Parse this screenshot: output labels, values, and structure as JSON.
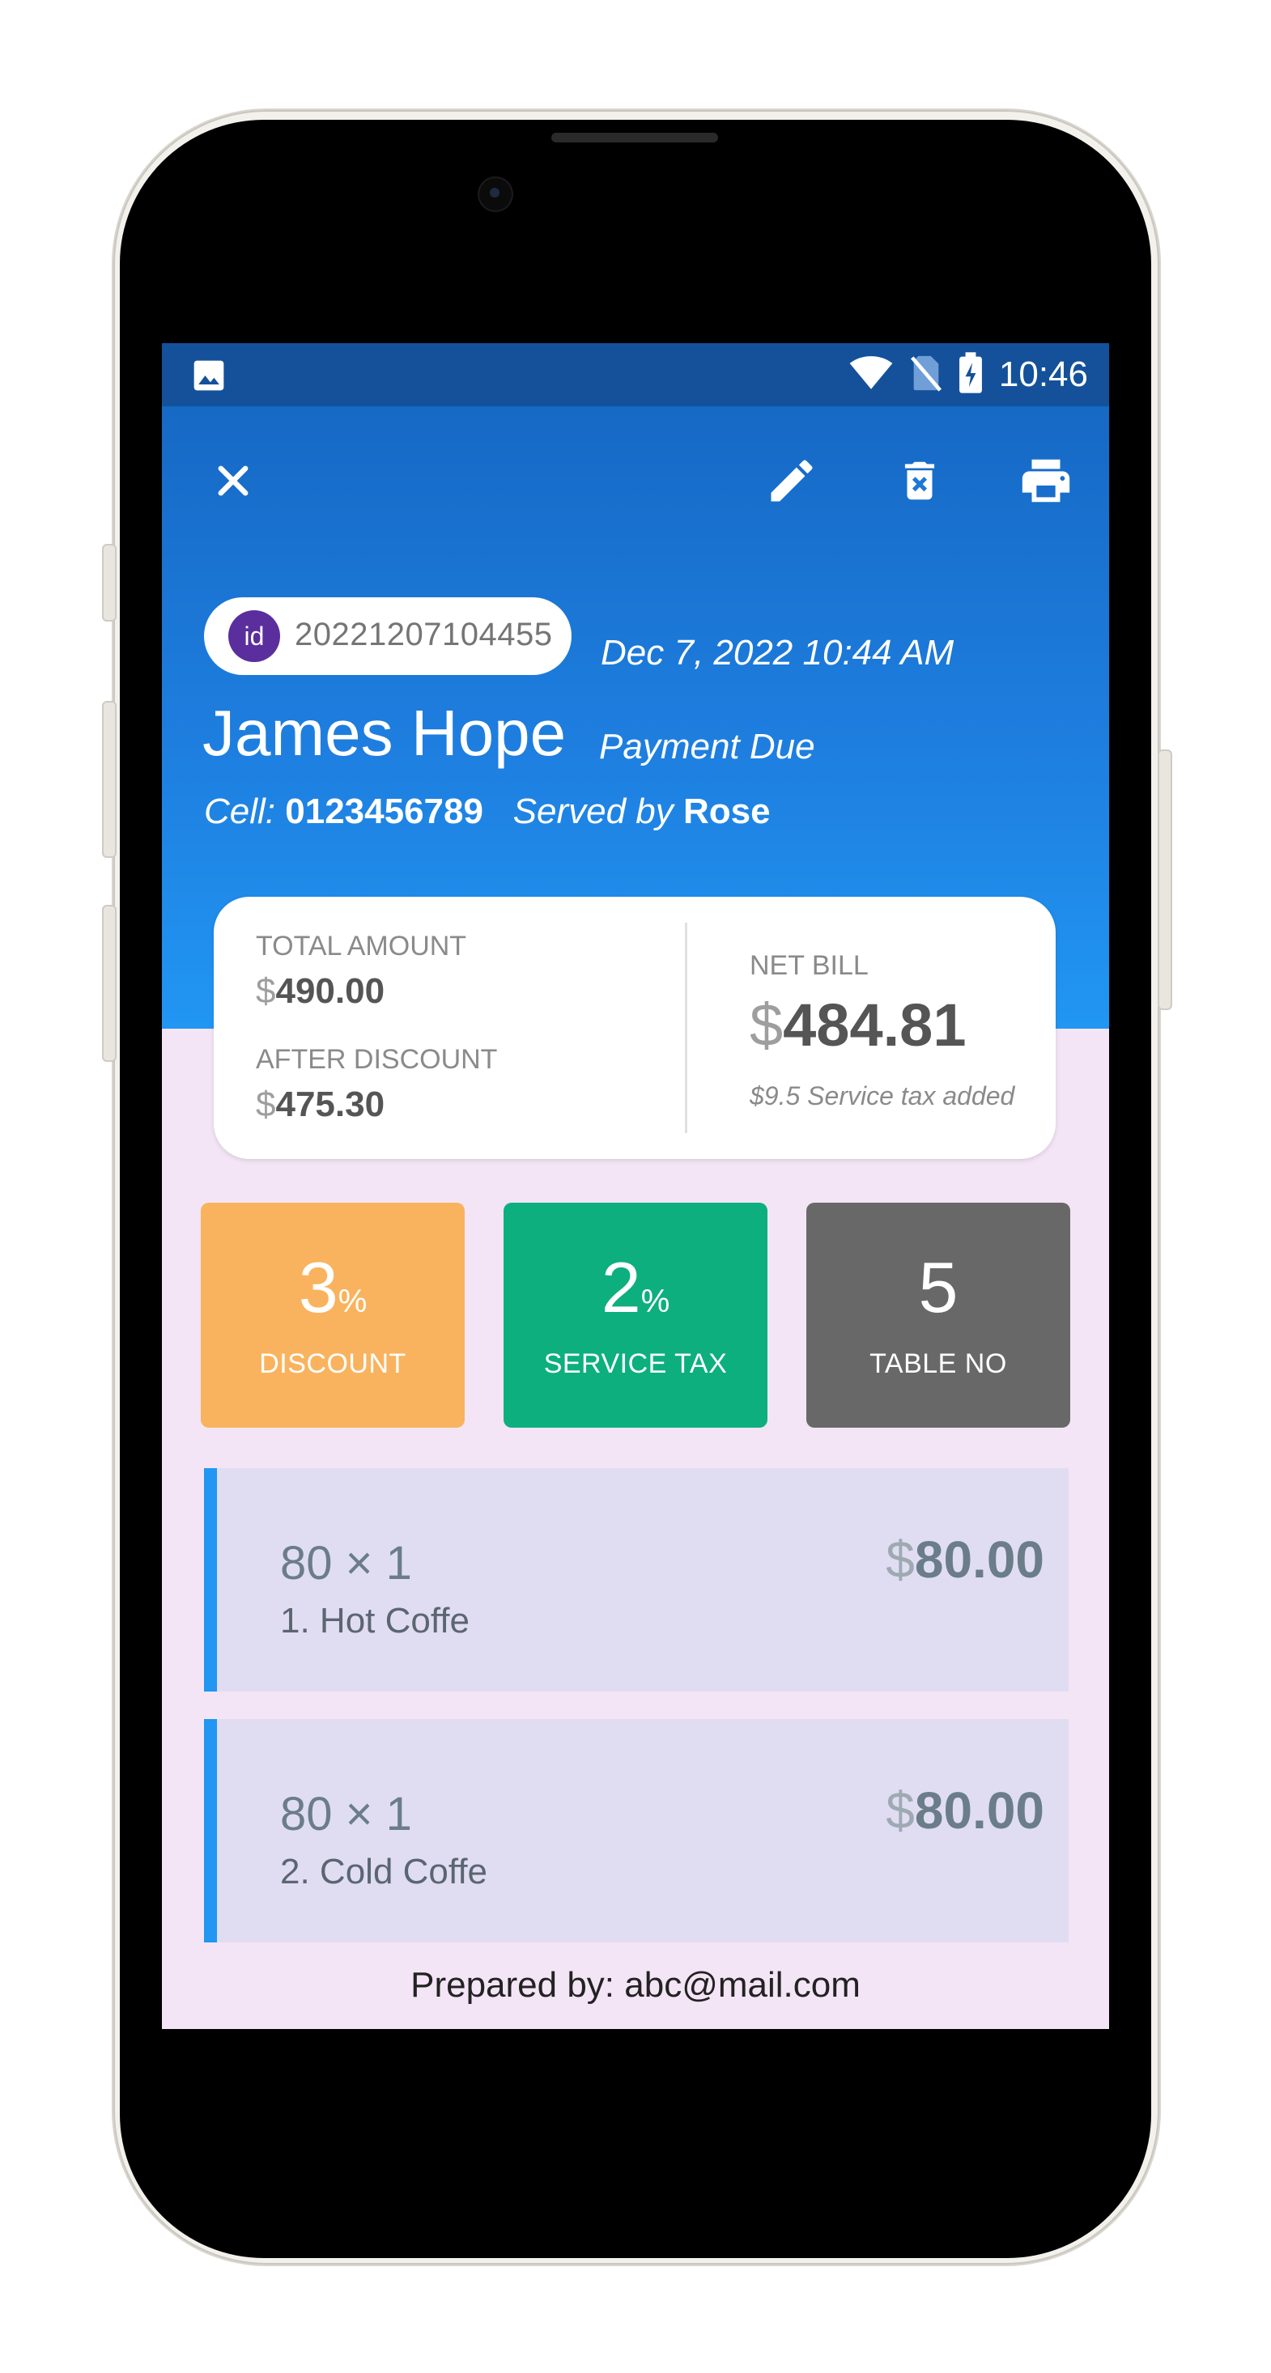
{
  "status_bar": {
    "time": "10:46"
  },
  "order": {
    "id_badge": "id",
    "id": "20221207104455",
    "date": "Dec 7, 2022 10:44 AM",
    "customer_name": "James Hope",
    "payment_status": "Payment Due",
    "cell_label": "Cell:",
    "cell": "0123456789",
    "served_label": "Served by",
    "server": "Rose"
  },
  "summary": {
    "total_label": "TOTAL AMOUNT",
    "total_currency": "$",
    "total_value": "490.00",
    "after_label": "AFTER DISCOUNT",
    "after_currency": "$",
    "after_value": "475.30",
    "net_label": "NET BILL",
    "net_currency": "$",
    "net_value": "484.81",
    "tax_note": "$9.5 Service tax added"
  },
  "tiles": [
    {
      "value": "3",
      "unit": "%",
      "label": "DISCOUNT",
      "color": "#f9b35e"
    },
    {
      "value": "2",
      "unit": "%",
      "label": "SERVICE TAX",
      "color": "#0daf7f"
    },
    {
      "value": "5",
      "unit": "",
      "label": "TABLE NO",
      "color": "#686868"
    }
  ],
  "items": [
    {
      "price": "80",
      "times": "×",
      "qty": "1",
      "name": "1. Hot Coffe",
      "currency": "$",
      "total": "80.00"
    },
    {
      "price": "80",
      "times": "×",
      "qty": "1",
      "name": "2. Cold Coffe",
      "currency": "$",
      "total": "80.00"
    }
  ],
  "footer": {
    "prepared_by": "Prepared by: abc@mail.com"
  },
  "colors": {
    "header": "#1565c0",
    "accent": "#2196f3",
    "background": "#f3e5f5"
  }
}
